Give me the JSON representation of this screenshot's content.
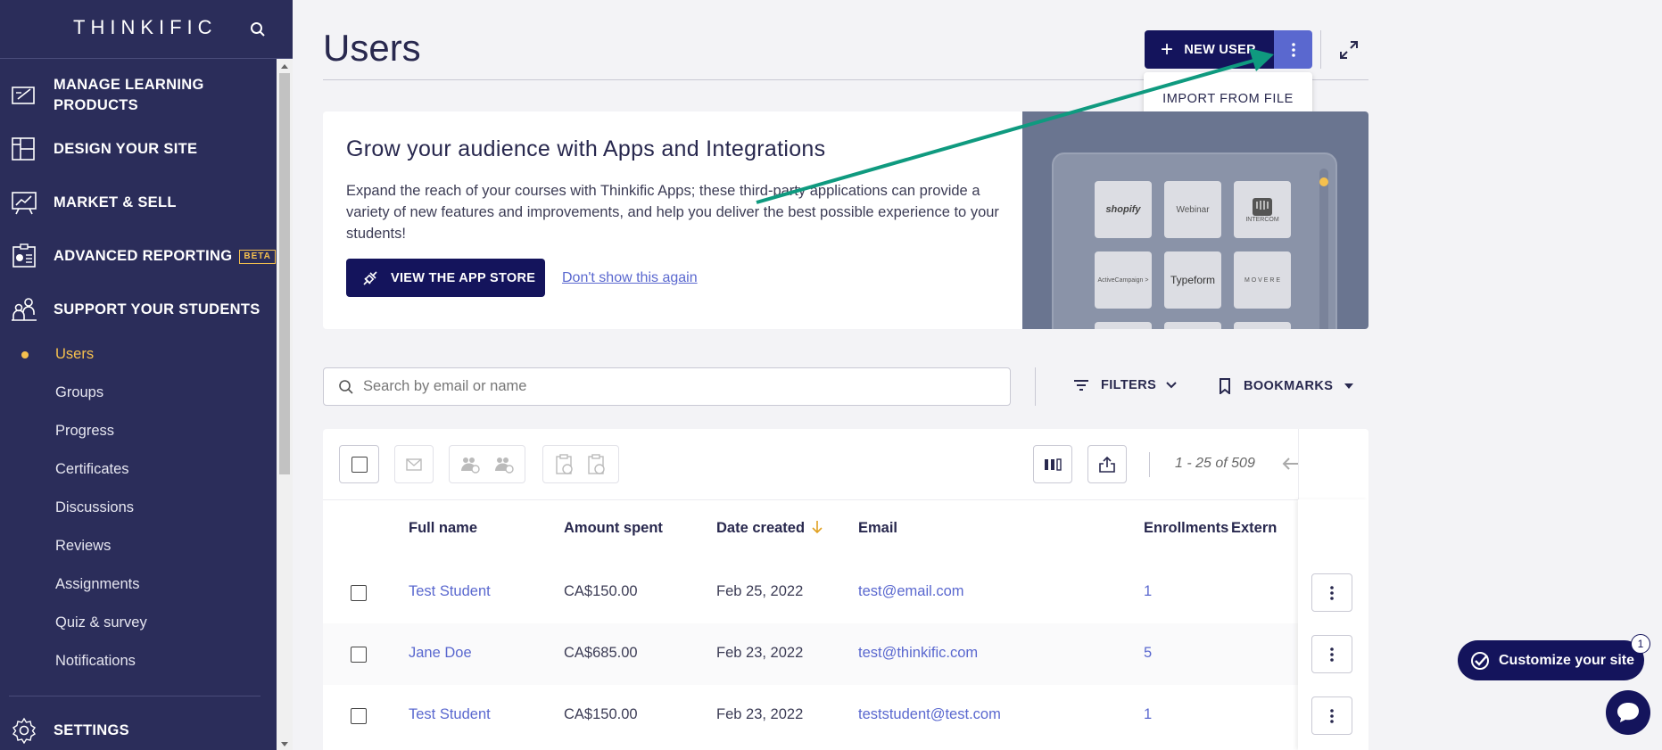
{
  "sidebar": {
    "logo": "THINKIFIC",
    "nav": [
      {
        "label": "MANAGE LEARNING\nPRODUCTS",
        "icon": "edit-board-icon"
      },
      {
        "label": "DESIGN YOUR SITE",
        "icon": "layout-icon"
      },
      {
        "label": "MARKET & SELL",
        "icon": "chart-board-icon"
      },
      {
        "label": "ADVANCED REPORTING",
        "icon": "report-icon",
        "badge": "BETA"
      },
      {
        "label": "SUPPORT YOUR STUDENTS",
        "icon": "students-icon"
      }
    ],
    "sub_items": [
      "Users",
      "Groups",
      "Progress",
      "Certificates",
      "Discussions",
      "Reviews",
      "Assignments",
      "Quiz & survey",
      "Notifications"
    ],
    "active_sub": "Users",
    "settings": "SETTINGS"
  },
  "header": {
    "title": "Users",
    "new_user": "NEW USER",
    "dropdown_item": "IMPORT FROM FILE"
  },
  "banner": {
    "title": "Grow your audience with Apps and Integrations",
    "body": "Expand the reach of your courses with Thinkific Apps; these third-party applications can provide a variety of new features and improvements, and help you deliver the best possible experience to your students!",
    "cta": "VIEW THE APP STORE",
    "dismiss": "Don't show this again",
    "tiles": [
      "shopify",
      "Webinar",
      "INTERCOM",
      "ActiveCampaign >",
      "Typeform",
      "M O V E R E"
    ]
  },
  "toolbar": {
    "search_placeholder": "Search by email or name",
    "filters": "FILTERS",
    "bookmarks": "BOOKMARKS",
    "pager": "1 - 25 of 509"
  },
  "table": {
    "headers": [
      "Full name",
      "Amount spent",
      "Date created",
      "Email",
      "Enrollments",
      "Extern"
    ],
    "rows": [
      {
        "name": "Test Student",
        "amount": "CA$150.00",
        "date": "Feb 25, 2022",
        "email": "test@email.com",
        "enrollments": "1"
      },
      {
        "name": "Jane Doe",
        "amount": "CA$685.00",
        "date": "Feb 23, 2022",
        "email": "test@thinkific.com",
        "enrollments": "5"
      },
      {
        "name": "Test Student",
        "amount": "CA$150.00",
        "date": "Feb 23, 2022",
        "email": "teststudent@test.com",
        "enrollments": "1"
      }
    ]
  },
  "floating": {
    "customize": "Customize your site",
    "badge": "1"
  },
  "colors": {
    "sidebar_bg": "#2b2d5a",
    "primary": "#14145c",
    "accent": "#5a68cf",
    "active": "#f5c04e",
    "annotation_arrow": "#0f9a7f"
  }
}
